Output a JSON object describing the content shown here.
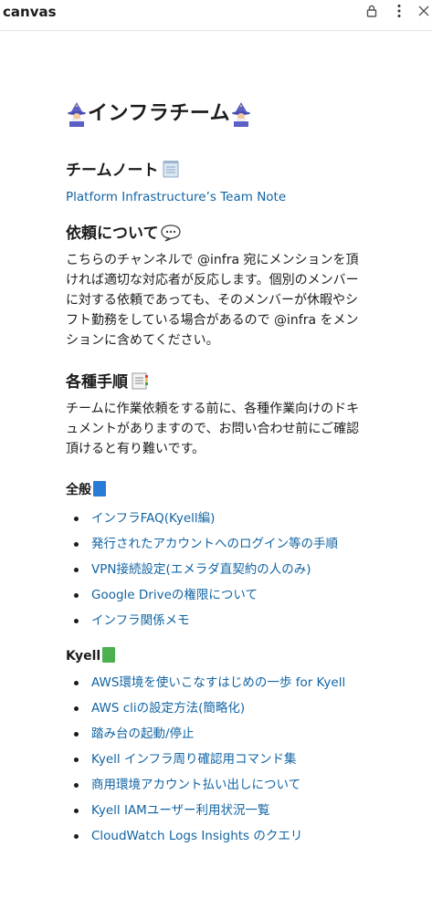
{
  "app": {
    "title": "canvas"
  },
  "icons": {
    "lock": "lock-icon",
    "more": "more-vertical-icon",
    "close": "close-icon"
  },
  "colors": {
    "link": "#1264a3",
    "text": "#1d1c1d",
    "blue_book": "#2a7bd5",
    "green_book": "#4caf50"
  },
  "doc": {
    "title": "インフラチーム",
    "team_note": {
      "heading": "チームノート",
      "link": "Platform Infrastructure’s Team Note"
    },
    "request": {
      "heading": "依頼について",
      "body": "こちらのチャンネルで @infra 宛にメンションを頂ければ適切な対応者が反応します。個別のメンバーに対する依頼であっても、そのメンバーが休暇やシフト勤務をしている場合があるので @infra をメンションに含めてください。"
    },
    "procedures": {
      "heading": "各種手順",
      "body": "チームに作業依頼をする前に、各種作業向けのドキュメントがありますので、お問い合わせ前にご確認頂けると有り難いです。"
    },
    "general": {
      "heading": "全般",
      "items": [
        "インフラFAQ(Kyell編)",
        "発行されたアカウントへのログイン等の手順",
        "VPN接続設定(エメラダ直契約の人のみ)",
        "Google Driveの権限について",
        "インフラ関係メモ"
      ]
    },
    "kyell": {
      "heading": "Kyell",
      "items": [
        "AWS環境を使いこなすはじめの一歩 for Kyell",
        "AWS cliの設定方法(簡略化)",
        "踏み台の起動/停止",
        "Kyell インフラ周り確認用コマンド集",
        "商用環境アカウント払い出しについて",
        "Kyell IAMユーザー利用状況一覧",
        "CloudWatch Logs Insights のクエリ"
      ]
    }
  }
}
